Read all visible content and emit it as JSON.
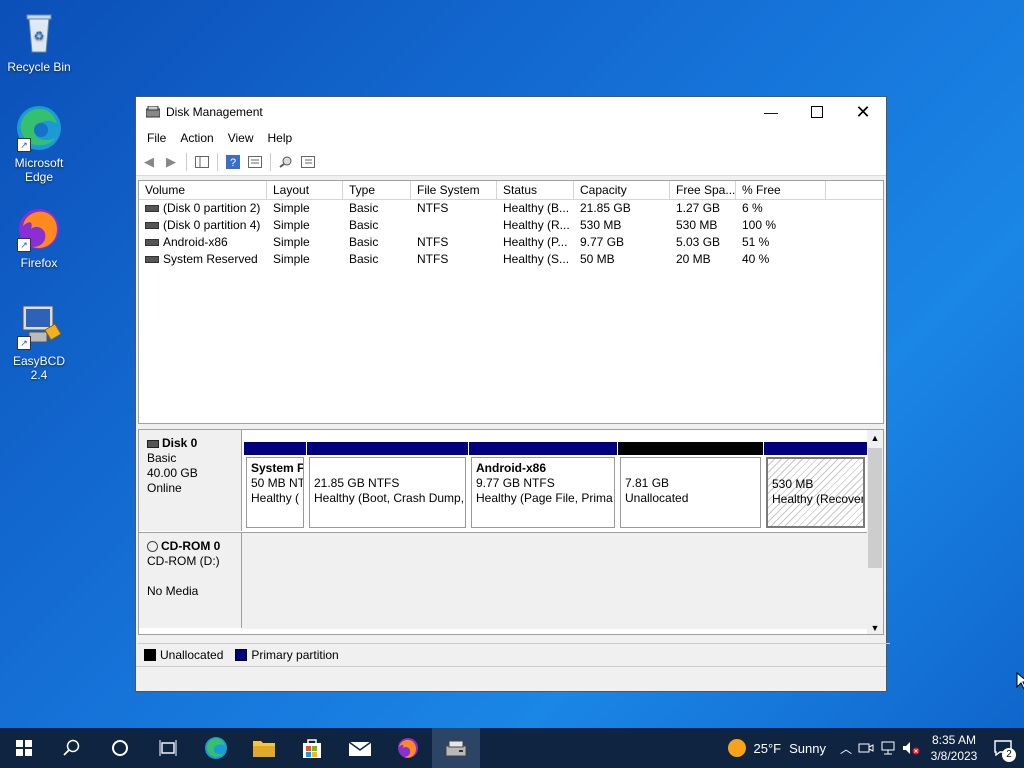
{
  "desktop": {
    "icons": [
      {
        "label": "Recycle Bin"
      },
      {
        "label": "Microsoft Edge"
      },
      {
        "label": "Firefox"
      },
      {
        "label": "EasyBCD 2.4"
      }
    ]
  },
  "window": {
    "title": "Disk Management",
    "menu": [
      "File",
      "Action",
      "View",
      "Help"
    ]
  },
  "volumes": {
    "columns": [
      "Volume",
      "Layout",
      "Type",
      "File System",
      "Status",
      "Capacity",
      "Free Spa...",
      "% Free"
    ],
    "rows": [
      [
        "(Disk 0 partition 2)",
        "Simple",
        "Basic",
        "NTFS",
        "Healthy (B...",
        "21.85 GB",
        "1.27 GB",
        "6 %"
      ],
      [
        "(Disk 0 partition 4)",
        "Simple",
        "Basic",
        "",
        "Healthy (R...",
        "530 MB",
        "530 MB",
        "100 %"
      ],
      [
        "Android-x86",
        "Simple",
        "Basic",
        "NTFS",
        "Healthy (P...",
        "9.77 GB",
        "5.03 GB",
        "51 %"
      ],
      [
        "System Reserved",
        "Simple",
        "Basic",
        "NTFS",
        "Healthy (S...",
        "50 MB",
        "20 MB",
        "40 %"
      ]
    ]
  },
  "disk0": {
    "name": "Disk 0",
    "type": "Basic",
    "size": "40.00 GB",
    "state": "Online",
    "partitions": [
      {
        "name": "System F",
        "size": "50 MB NT",
        "status": "Healthy ("
      },
      {
        "name": "",
        "size": "21.85 GB NTFS",
        "status": "Healthy (Boot, Crash Dump,"
      },
      {
        "name": "Android-x86",
        "size": "9.77 GB NTFS",
        "status": "Healthy (Page File, Prima"
      },
      {
        "name": "",
        "size": "7.81 GB",
        "status": "Unallocated"
      },
      {
        "name": "",
        "size": "530 MB",
        "status": "Healthy (Recover"
      }
    ]
  },
  "cdrom": {
    "name": "CD-ROM 0",
    "drive": "CD-ROM (D:)",
    "media": "No Media"
  },
  "legend": {
    "unallocated": "Unallocated",
    "primary": "Primary partition",
    "unallocated_color": "#000000",
    "primary_color": "#00007e"
  },
  "taskbar": {
    "weather_temp": "25°F",
    "weather_text": "Sunny",
    "time": "8:35 AM",
    "date": "3/8/2023",
    "notifications": "2"
  }
}
